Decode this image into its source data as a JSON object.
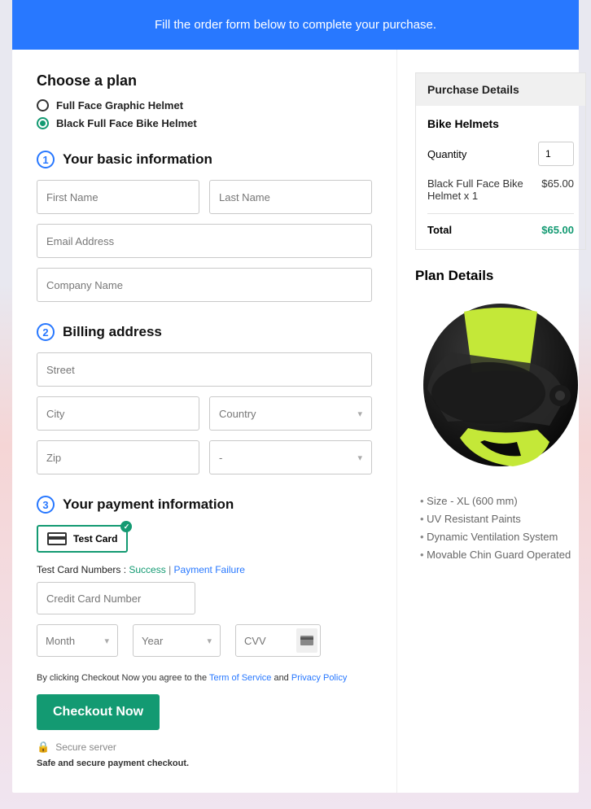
{
  "banner": "Fill the order form below to complete your purchase.",
  "choose_plan": {
    "heading": "Choose a plan",
    "options": [
      {
        "label": "Full Face Graphic Helmet",
        "selected": false
      },
      {
        "label": "Black Full Face Bike Helmet",
        "selected": true
      }
    ]
  },
  "section1": {
    "num": "1",
    "title": "Your basic information"
  },
  "basic": {
    "first_name_ph": "First Name",
    "last_name_ph": "Last Name",
    "email_ph": "Email Address",
    "company_ph": "Company Name"
  },
  "section2": {
    "num": "2",
    "title": "Billing address"
  },
  "billing": {
    "street_ph": "Street",
    "city_ph": "City",
    "country_ph": "Country",
    "zip_ph": "Zip",
    "state_ph": "-"
  },
  "section3": {
    "num": "3",
    "title": "Your payment information"
  },
  "payment": {
    "test_card_label": "Test  Card",
    "tcn_prefix": "Test Card Numbers : ",
    "success": "Success",
    "sep": " | ",
    "failure": "Payment Failure",
    "cc_ph": "Credit Card Number",
    "month_ph": "Month",
    "year_ph": "Year",
    "cvv_ph": "CVV"
  },
  "terms": {
    "prefix": "By clicking Checkout Now you agree to the ",
    "tos": "Term of Service",
    "and": " and ",
    "pp": "Privacy Policy"
  },
  "checkout_label": "Checkout Now",
  "secure_server": "Secure server",
  "safe_text": "Safe and secure payment checkout.",
  "purchase": {
    "head": "Purchase Details",
    "title": "Bike Helmets",
    "qty_label": "Quantity",
    "qty_value": "1",
    "item_name": "Black Full Face Bike Helmet x 1",
    "item_price": "$65.00",
    "total_label": "Total",
    "total_amount": "$65.00"
  },
  "plan": {
    "heading": "Plan Details",
    "bullets": [
      "Size - XL (600 mm)",
      "UV Resistant Paints",
      "Dynamic Ventilation System",
      "Movable Chin Guard Operated"
    ]
  }
}
